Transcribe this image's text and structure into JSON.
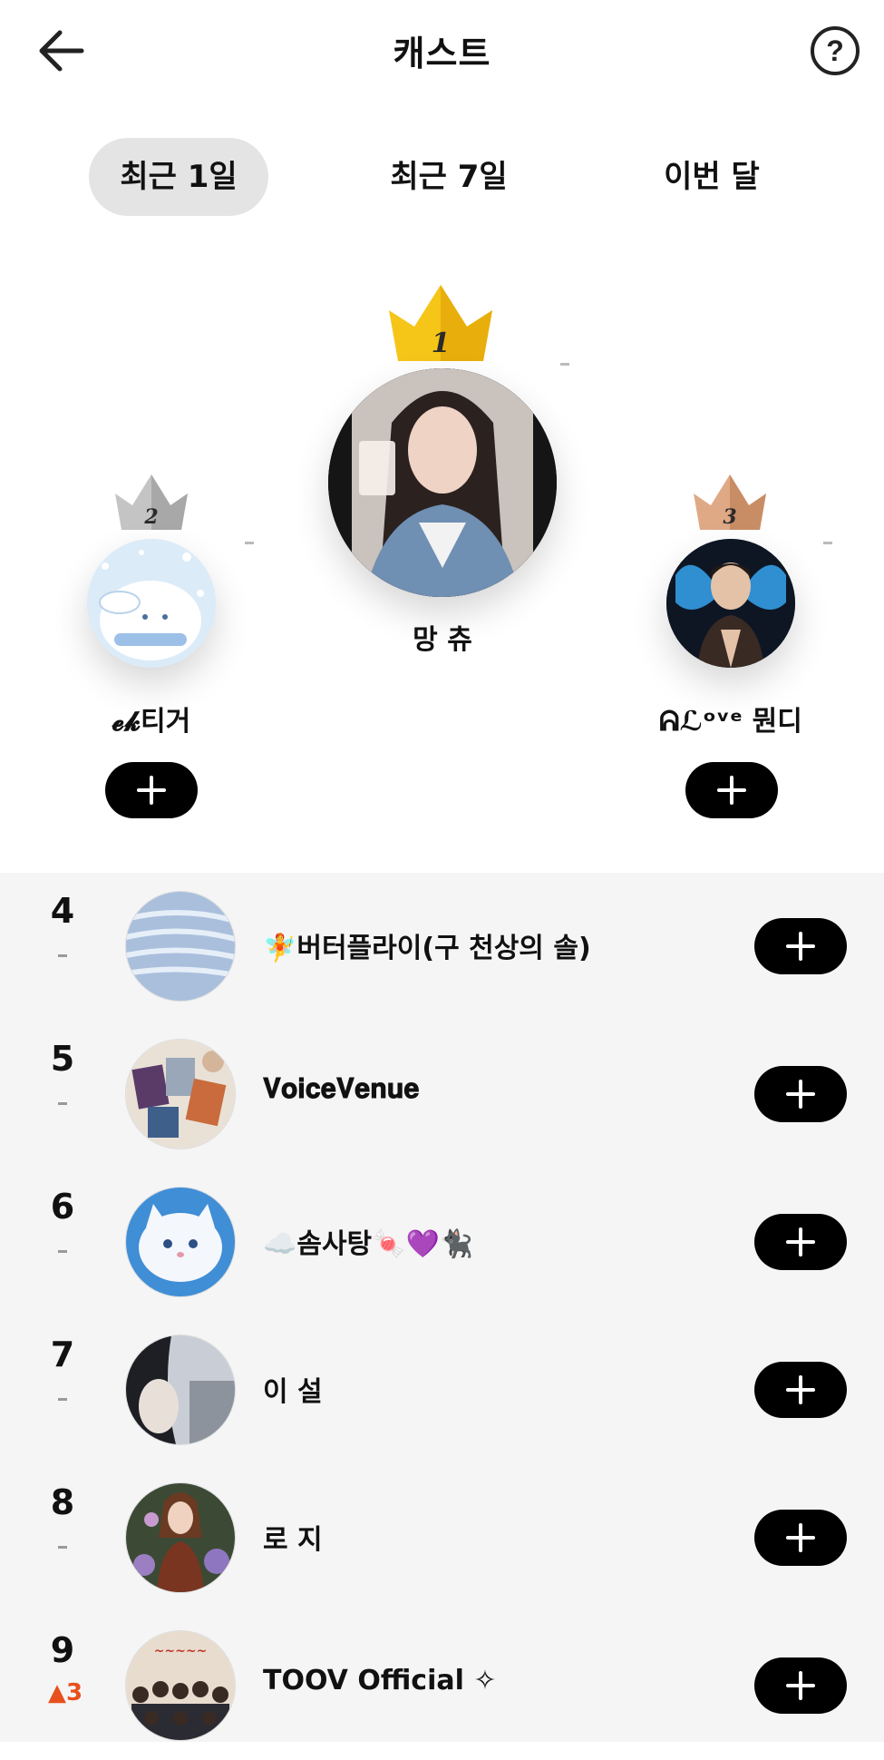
{
  "header": {
    "title": "캐스트",
    "back_icon": "arrow-left-icon",
    "help_icon": "question-circle-icon"
  },
  "tabs": [
    {
      "label": "최근 1일",
      "active": true
    },
    {
      "label": "최근 7일",
      "active": false
    },
    {
      "label": "이번 달",
      "active": false
    }
  ],
  "podium": {
    "first": {
      "rank": "1",
      "name": "망 츄",
      "change": "-",
      "crown_color": "#f5c518"
    },
    "second": {
      "rank": "2",
      "name": "𝓮𝓴티거",
      "change": "-",
      "crown_color": "#b5b5b5"
    },
    "third": {
      "rank": "3",
      "name": "ᕱℒᵒᵛᵉ 뭔디",
      "change": "-",
      "crown_color": "#d9a07a"
    }
  },
  "list": [
    {
      "rank": "4",
      "change": "-",
      "name": "🧚버터플라이(구 천상의 솔)"
    },
    {
      "rank": "5",
      "change": "-",
      "name": "𝐕𝐨𝐢𝐜𝐞𝐕𝐞𝐧𝐮𝐞"
    },
    {
      "rank": "6",
      "change": "-",
      "name": "☁️솜사탕🍬💜🐈‍⬛"
    },
    {
      "rank": "7",
      "change": "-",
      "name": "이 설"
    },
    {
      "rank": "8",
      "change": "-",
      "name": "로 지"
    },
    {
      "rank": "9",
      "change": "▲3",
      "name": "TOOV Official ✧"
    }
  ],
  "colors": {
    "accent": "#000000",
    "up": "#e8501d",
    "list_bg": "#f5f5f5"
  }
}
